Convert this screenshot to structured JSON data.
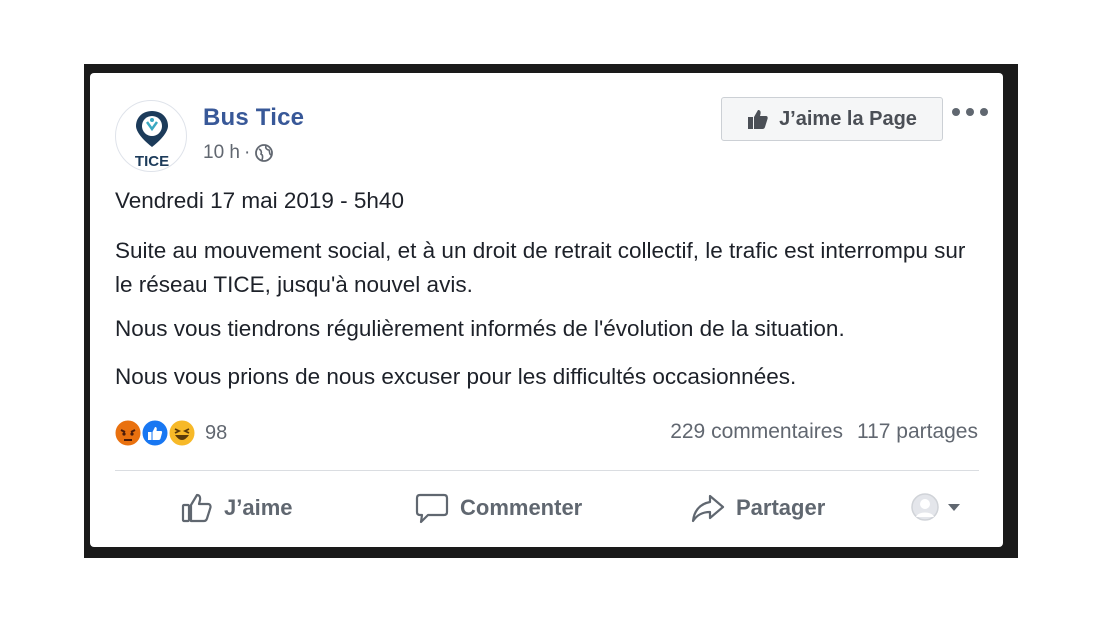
{
  "post": {
    "page_name": "Bus Tice",
    "avatar_label": "TICE",
    "time": "10 h",
    "time_separator": "·",
    "privacy_icon": "globe-icon",
    "like_page_label": "J’aime la Page",
    "date_line": "Vendredi 17 mai 2019 - 5h40",
    "paragraph1": "Suite au mouvement social, et à un droit de retrait collectif, le trafic est interrompu sur le réseau TICE, jusqu'à nouvel avis.",
    "paragraph2": "Nous vous tiendrons régulièrement informés de l'évolution de la situation.",
    "paragraph3": "Nous vous prions de nous excuser pour les difficultés occasionnées."
  },
  "engagement": {
    "reaction_icons": [
      "angry-reaction-icon",
      "like-reaction-icon",
      "haha-reaction-icon"
    ],
    "reaction_count": "98",
    "comments": "229 commentaires",
    "shares": "117 partages"
  },
  "actions": {
    "like": "J’aime",
    "comment": "Commenter",
    "share": "Partager"
  },
  "colors": {
    "brand_blue": "#385898",
    "text": "#1d2129",
    "muted": "#616770",
    "logo_navy": "#1c3b5a",
    "logo_teal": "#3aa8c1"
  }
}
